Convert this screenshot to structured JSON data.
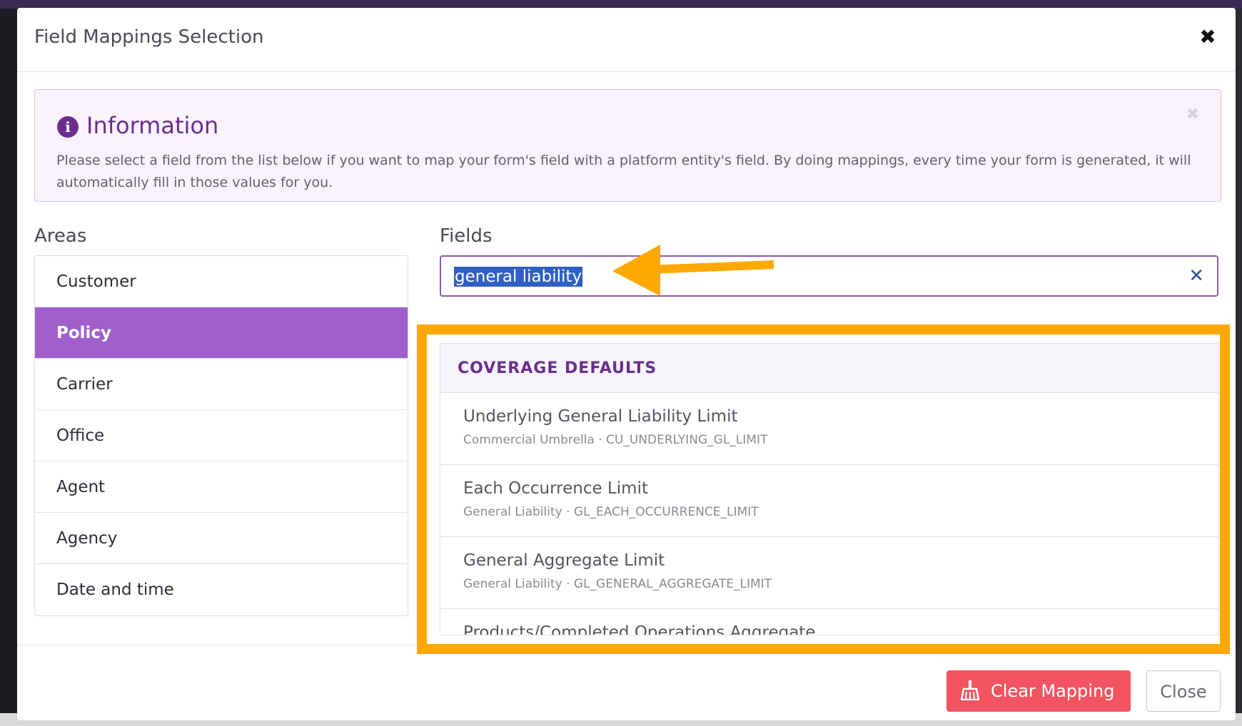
{
  "modal": {
    "title": "Field Mappings Selection",
    "close_icon": "close-icon"
  },
  "info": {
    "title": "Information",
    "text": "Please select a field from the list below if you want to map your form's field with a platform entity's field. By doing mappings, every time your form is generated, it will automatically fill in those values for you."
  },
  "areas": {
    "label": "Areas",
    "items": [
      {
        "label": "Customer",
        "active": false
      },
      {
        "label": "Policy",
        "active": true
      },
      {
        "label": "Carrier",
        "active": false
      },
      {
        "label": "Office",
        "active": false
      },
      {
        "label": "Agent",
        "active": false
      },
      {
        "label": "Agency",
        "active": false
      },
      {
        "label": "Date and time",
        "active": false
      }
    ]
  },
  "fields": {
    "label": "Fields",
    "search_value": "general liability",
    "group": "COVERAGE DEFAULTS",
    "results": [
      {
        "name": "Underlying General Liability Limit",
        "sub": "Commercial Umbrella · CU_UNDERLYING_GL_LIMIT"
      },
      {
        "name": "Each Occurrence Limit",
        "sub": "General Liability · GL_EACH_OCCURRENCE_LIMIT"
      },
      {
        "name": "General Aggregate Limit",
        "sub": "General Liability · GL_GENERAL_AGGREGATE_LIMIT"
      },
      {
        "name": "Products/Completed Operations Aggregate",
        "sub": ""
      }
    ]
  },
  "footer": {
    "clear_label": "Clear Mapping",
    "close_label": "Close"
  },
  "colors": {
    "accent": "#a05fca",
    "brand": "#6b2e8e",
    "danger": "#f25561",
    "annotation": "#ffa800"
  }
}
